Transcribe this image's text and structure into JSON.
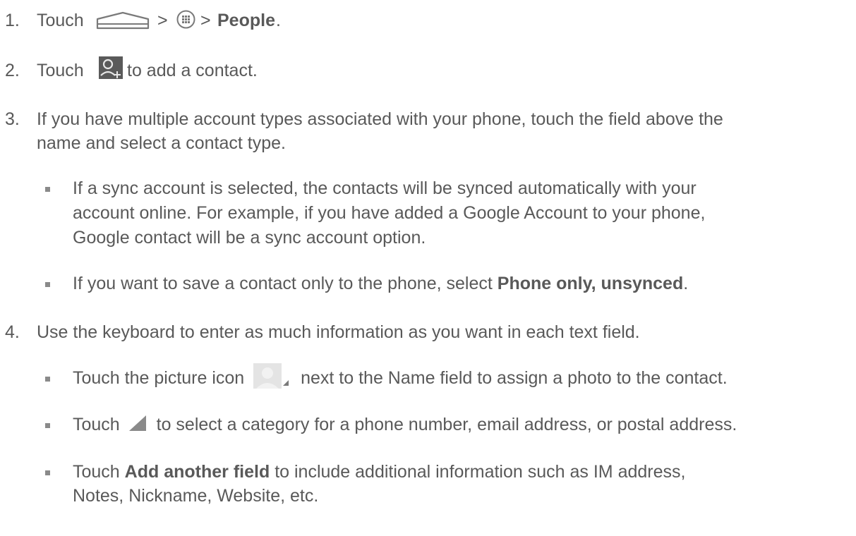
{
  "steps": [
    {
      "number": "1.",
      "parts": [
        "Touch",
        ">",
        ">",
        "People",
        "."
      ],
      "icons": [
        "home-icon",
        "apps-icon"
      ]
    },
    {
      "number": "2.",
      "parts": [
        "Touch",
        "to add a contact."
      ],
      "icons": [
        "add-contact-icon"
      ]
    },
    {
      "number": "3.",
      "lines": [
        "If you have multiple account types associated with your phone, touch the field above the",
        "name and select a contact type."
      ],
      "bullets": [
        {
          "lines": [
            "If a sync account is selected, the contacts will be synced automatically with your",
            "account online. For example, if you have added a Google Account to your phone,",
            "Google contact will be a sync account option."
          ]
        },
        {
          "text_before": "If you want to save a contact only to the phone, select",
          "bold": "Phone only, unsynced",
          "text_after": "."
        }
      ]
    },
    {
      "number": "4.",
      "lines": [
        "Use the keyboard to enter as much information as you want in each text field."
      ],
      "bullets": [
        {
          "text_before": "Touch the picture icon",
          "icon": "contact-picture-icon",
          "text_after": "next to the Name field to assign a photo to the contact."
        },
        {
          "text_before": "Touch",
          "icon": "dropdown-triangle-icon",
          "text_after": "to select a category for a phone number, email address, or postal address."
        },
        {
          "text_before": "Touch",
          "bold": "Add another field",
          "text_after": "to include additional information such as IM address,",
          "line2": "Notes, Nickname, Website, etc."
        }
      ]
    }
  ]
}
